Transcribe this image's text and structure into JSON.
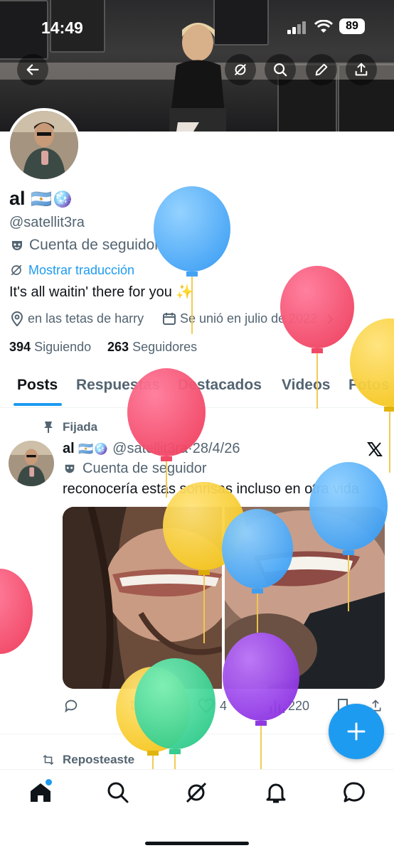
{
  "status_bar": {
    "time": "14:49",
    "battery": "89"
  },
  "profile": {
    "name": "al",
    "name_emoji": "🇦🇷🪩",
    "handle": "@satellit3ra",
    "account_type": "Cuenta de seguidor",
    "translate_link": "Mostrar traducción",
    "bio": "It's all waitin' there for you",
    "bio_emoji": "✨",
    "location": "en las tetas de harry",
    "joined": "Se unió en julio de 2022",
    "following_count": "394",
    "following_label": "Siguiendo",
    "followers_count": "263",
    "followers_label": "Seguidores"
  },
  "tabs": [
    "Posts",
    "Respuestas",
    "Destacados",
    "Videos",
    "Fotos"
  ],
  "pinned_post": {
    "pinned_label": "Fijada",
    "author": "al",
    "author_emoji": "🇦🇷🪩",
    "handle": "@satellit3ra",
    "sep": "·",
    "date": "28/4/26",
    "account_type": "Cuenta de seguidor",
    "text": "reconocería estas sonrisas incluso en otra vida",
    "likes": "4",
    "views": "220"
  },
  "next_post": {
    "repost_label": "Reposteaste"
  },
  "icons": [
    "back-arrow-icon",
    "no-translate-icon",
    "search-icon",
    "edit-pen-icon",
    "share-icon",
    "mask-icon",
    "location-pin-icon",
    "calendar-icon",
    "pin-icon",
    "x-logo-icon",
    "reply-icon",
    "retweet-icon",
    "like-icon",
    "views-icon",
    "bookmark-icon",
    "home-icon",
    "grok-icon",
    "bell-icon",
    "chat-icon",
    "compose-plus-icon"
  ],
  "colors": {
    "accent": "#1d9bf0",
    "text": "#0f1419",
    "muted": "#536471"
  }
}
